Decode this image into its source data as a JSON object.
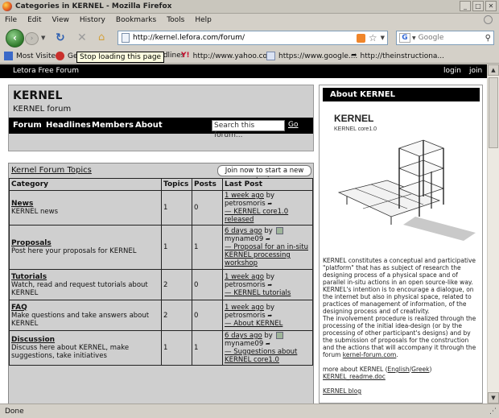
{
  "window": {
    "title": "Categories in KERNEL - Mozilla Firefox"
  },
  "menu": [
    "File",
    "Edit",
    "View",
    "History",
    "Bookmarks",
    "Tools",
    "Help"
  ],
  "nav": {
    "url": "http://kernel.lefora.com/forum/",
    "search_placeholder": "Google"
  },
  "bookmarks": {
    "most_visited": "Most Visited",
    "getting_started_clip": "Ge",
    "headlines": "Headlines",
    "yahoo": "http://www.yahoo.co...",
    "google": "https://www.google....",
    "instructional": "http://theinstructiona..."
  },
  "tooltip": "Stop loading this page",
  "site": {
    "brand": "Letora Free Forum",
    "login": "login",
    "join": "join",
    "name": "KERNEL",
    "subtitle": "KERNEL forum",
    "nav": [
      "Forum",
      "Headlines",
      "Members",
      "About"
    ],
    "search_placeholder": "Search this forum...",
    "go": "Go"
  },
  "forum": {
    "title": "Kernel Forum Topics",
    "join_button": "Join now to start a new topic",
    "columns": [
      "Category",
      "Topics",
      "Posts",
      "Last Post"
    ],
    "rows": [
      {
        "name": "News",
        "desc": "KERNEL news",
        "topics": "1",
        "posts": "0",
        "last_when": "1 week ago",
        "last_by": "by",
        "last_user": "petrosmoris",
        "last_topic": "— KERNEL core1.0 released",
        "avatar": false
      },
      {
        "name": "Proposals",
        "desc": "Post here your proposals for KERNEL",
        "topics": "1",
        "posts": "1",
        "last_when": "6 days ago",
        "last_by": "by",
        "last_user": "myname09",
        "last_topic": "— Proposal for an in-situ KERNEL processing workshop",
        "avatar": true
      },
      {
        "name": "Tutorials",
        "desc": "Watch, read and request tutorials about KERNEL",
        "topics": "2",
        "posts": "0",
        "last_when": "1 week ago",
        "last_by": "by",
        "last_user": "petrosmoris",
        "last_topic": "— KERNEL tutorials",
        "avatar": false
      },
      {
        "name": "FAQ",
        "desc": "Make questions and take answers about KERNEL",
        "topics": "2",
        "posts": "0",
        "last_when": "1 week ago",
        "last_by": "by",
        "last_user": "petrosmoris",
        "last_topic": "— About KERNEL",
        "avatar": false
      },
      {
        "name": "Discussion",
        "desc": "Discuss here about KERNEL, make suggestions, take initiatives",
        "topics": "1",
        "posts": "1",
        "last_when": "6 days ago",
        "last_by": "by",
        "last_user": "myname09",
        "last_topic": "— Suggestions about KERNEL core1.0",
        "avatar": true
      }
    ]
  },
  "about": {
    "title": "About KERNEL",
    "img_title": "KERNEL",
    "img_sub": "KERNEL core1.0",
    "p1": "KERNEL constitutes a conceptual and participative \"platform\" that has as subject of research the designing process of a physical space and of parallel in-situ actions in an open source-like way.",
    "p2": "KERNEL's intention is to encourage a dialogue, on the internet but also in physical space, related to practices of management of information, of the designing process and of creativity.",
    "p3": "The involvement procedure is realized through the processing of the initial idea-design (or by the processing of other participant's designs) and by the submission of proposals for the construction and the actions that will accompany it through the forum",
    "p3_link": "kernel-forum.com",
    "more": "more about KERNEL (",
    "english": "English",
    "greek": "Greek",
    "readme": "KERNEL_readme.doc",
    "blog": "KERNEL blog"
  },
  "status": "Done"
}
